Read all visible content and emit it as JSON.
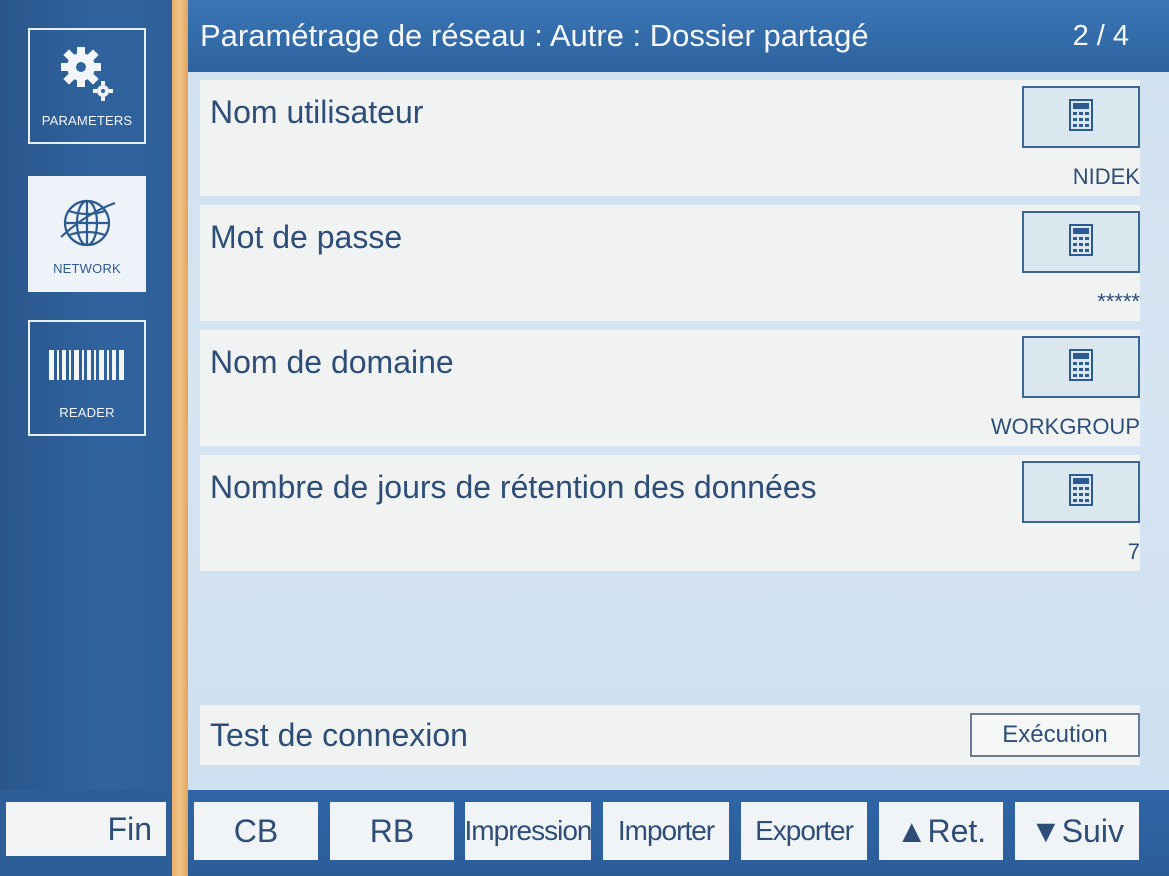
{
  "sidebar": {
    "items": [
      {
        "label": "PARAMETERS",
        "icon": "gear-icon",
        "active": false
      },
      {
        "label": "NETWORK",
        "icon": "globe-icon",
        "active": true
      },
      {
        "label": "READER",
        "icon": "barcode-icon",
        "active": false
      }
    ]
  },
  "header": {
    "title": "Paramétrage de réseau : Autre : Dossier partagé",
    "page": "2 / 4"
  },
  "settings": [
    {
      "label": "Nom utilisateur",
      "value": "NIDEK",
      "button_icon": "calculator-icon"
    },
    {
      "label": "Mot de passe",
      "value": "*****",
      "button_icon": "calculator-icon"
    },
    {
      "label": "Nom de domaine",
      "value": "WORKGROUP",
      "button_icon": "calculator-icon"
    },
    {
      "label": "Nombre de jours de rétention des données",
      "value": "7",
      "button_icon": "calculator-icon"
    }
  ],
  "connection": {
    "label": "Test de connexion",
    "button": "Exécution"
  },
  "footer": {
    "fin": "Fin",
    "buttons": [
      "CB",
      "RB",
      "Impression",
      "Importer",
      "Exporter",
      "▲Ret.",
      "▼Suiv"
    ]
  },
  "colors": {
    "rail": "#2f5d93",
    "accent_orange": "#f2c689",
    "header": "#3b75b6",
    "row_bg": "#f1f3f2",
    "text": "#2e4e78"
  }
}
